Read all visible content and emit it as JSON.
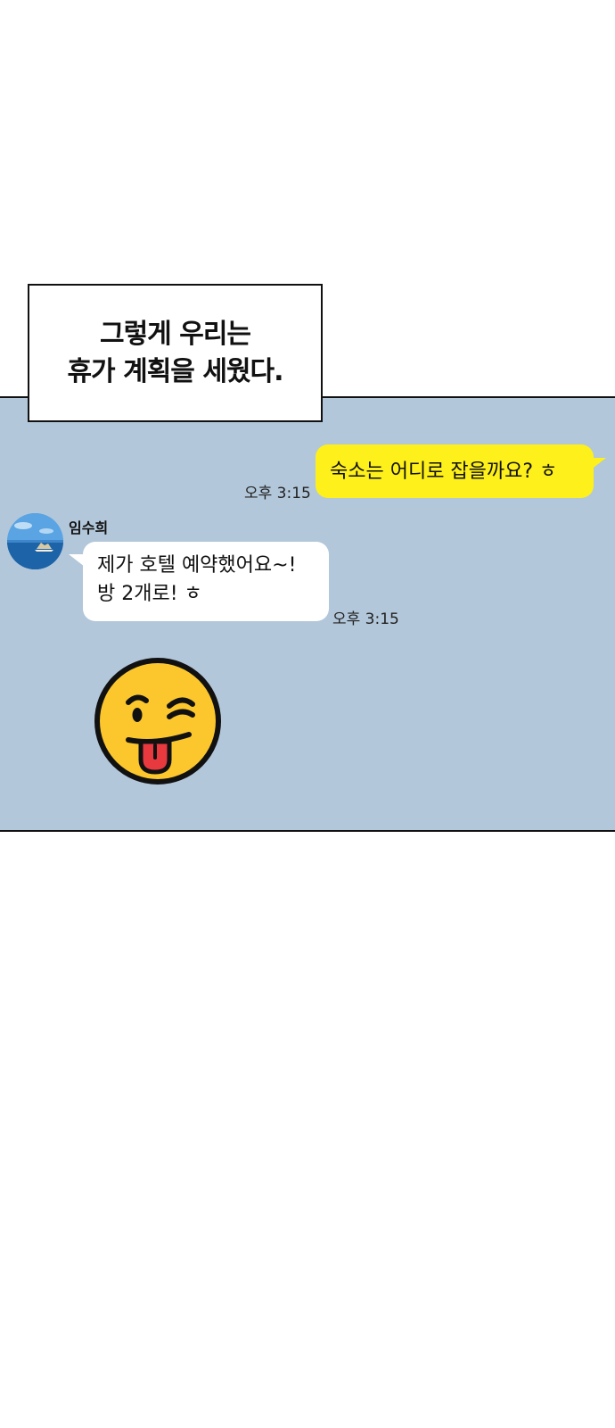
{
  "caption": {
    "line1": "그렇게 우리는",
    "line2": "휴가 계획을 세웠다."
  },
  "chat": {
    "outgoing": {
      "text": "숙소는 어디로 잡을까요? ㅎ",
      "time": "오후 3:15"
    },
    "incoming": {
      "sender": "임수희",
      "line1": "제가 호텔 예약했어요~!",
      "line2": "방 2개로! ㅎ",
      "time": "오후 3:15"
    },
    "sticker": "winking-tongue-emoji"
  },
  "colors": {
    "chat_background": "#b2c7da",
    "outgoing_bubble": "#fef01b",
    "incoming_bubble": "#ffffff",
    "emoji_face": "#fcc72c",
    "emoji_tongue": "#e8393f"
  }
}
